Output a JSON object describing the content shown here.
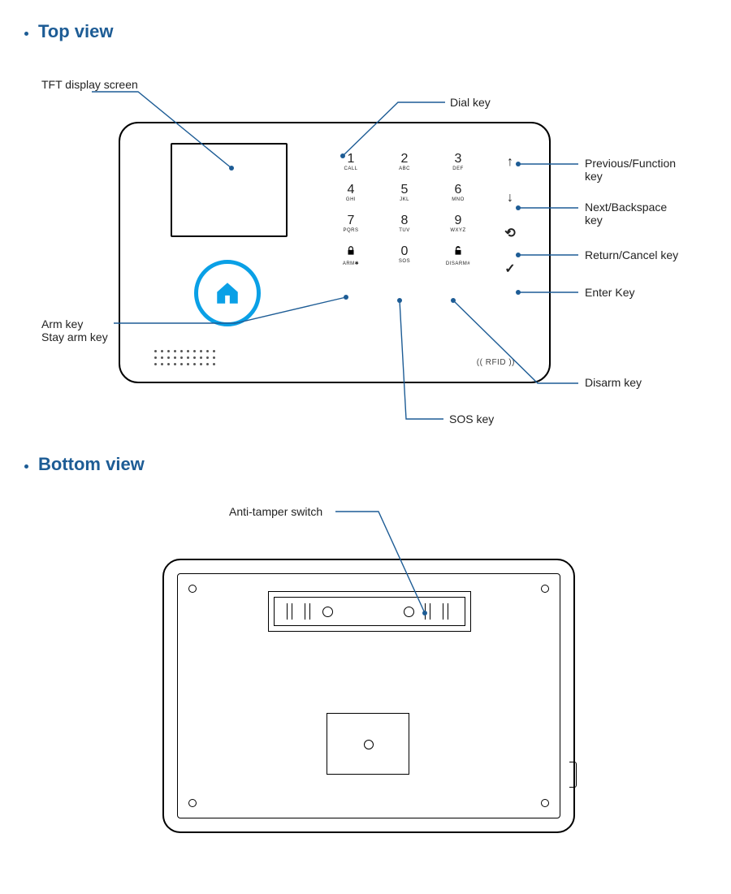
{
  "sections": {
    "top": "Top view",
    "bottom": "Bottom view"
  },
  "callouts": {
    "tft": "TFT display screen",
    "dial": "Dial key",
    "prev": "Previous/Function\nkey",
    "next": "Next/Backspace\nkey",
    "return": "Return/Cancel key",
    "enter": "Enter Key",
    "arm": "Arm key\nStay arm key",
    "disarm": "Disarm key",
    "sos": "SOS key",
    "anti": "Anti-tamper switch"
  },
  "keypad": [
    [
      {
        "d": "1",
        "s": "CALL"
      },
      {
        "d": "2",
        "s": "ABC"
      },
      {
        "d": "3",
        "s": "DEF"
      }
    ],
    [
      {
        "d": "4",
        "s": "GHI"
      },
      {
        "d": "5",
        "s": "JKL"
      },
      {
        "d": "6",
        "s": "MNO"
      }
    ],
    [
      {
        "d": "7",
        "s": "PQRS"
      },
      {
        "d": "8",
        "s": "TUV"
      },
      {
        "d": "9",
        "s": "WXYZ"
      }
    ]
  ],
  "bottomRow": [
    {
      "icon": "lock",
      "sub": "ARM✱"
    },
    {
      "icon": "zero",
      "d": "0",
      "sub": "SOS"
    },
    {
      "icon": "unlock",
      "sub": "DISARM#"
    }
  ],
  "navKeys": [
    "up",
    "down",
    "back",
    "check"
  ],
  "rfidLabel": "(( RFID ))",
  "colors": {
    "accent": "#1d5c95",
    "homeRing": "#0aa0e6"
  }
}
